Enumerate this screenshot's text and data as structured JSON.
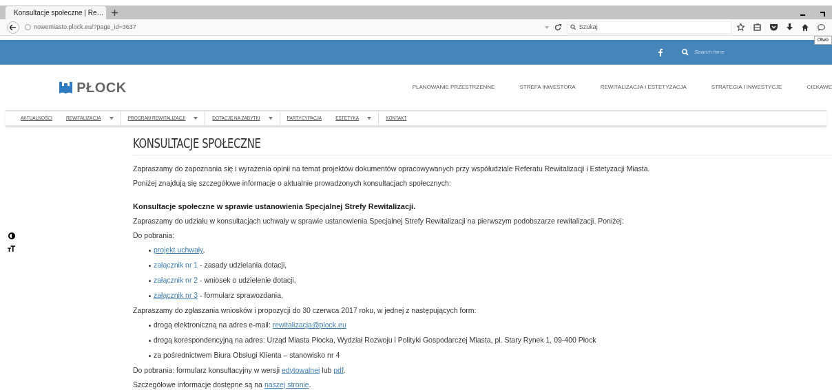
{
  "browser": {
    "tab_title": "Konsultacje społeczne | Re…",
    "url": "nowemiasto.plock.eu/?page_id=3637",
    "search_placeholder": "Szukaj",
    "tooltip": "Otwó"
  },
  "topbar": {
    "search_placeholder": "Search here"
  },
  "logo": {
    "text": "PŁOCK"
  },
  "main_nav": [
    "PLANOWANIE PRZESTRZENNE",
    "STREFA INWESTORA",
    "REWITALIZACJA I ESTETYZACJA",
    "STRATEGIA I INWESTYCJE",
    "CIEKAWE"
  ],
  "sub_nav": [
    {
      "label": "AKTUALNOŚCI",
      "dropdown": false
    },
    {
      "label": "REWITALIZACJA",
      "dropdown": true
    },
    {
      "label": "PROGRAM REWITALIZACJI",
      "dropdown": true
    },
    {
      "label": "DOTACJE NA ZABYTKI",
      "dropdown": true
    },
    {
      "label": "PARTYCYPACJA",
      "dropdown": false
    },
    {
      "label": "ESTETYKA",
      "dropdown": true
    },
    {
      "label": "KONTAKT",
      "dropdown": false
    }
  ],
  "page_title": "KONSULTACJE SPOŁECZNE",
  "content": [
    {
      "kind": "text",
      "parts": [
        {
          "text": "Zapraszamy do zapoznania się i wyrażenia opinii na temat projektów dokumentów opracowywanych przy współudziale Referatu Rewitalizacji i Estetyzacji Miasta."
        }
      ]
    },
    {
      "kind": "text",
      "parts": [
        {
          "text": "Poniżej znajdują się szczegółowe informacje o aktualnie prowadzonych konsultacjach społecznych:"
        }
      ]
    },
    {
      "kind": "heading",
      "parts": [
        {
          "text": "Konsultacje społeczne w sprawie ustanowienia Specjalnej Strefy Rewitalizacji."
        }
      ]
    },
    {
      "kind": "text",
      "parts": [
        {
          "text": "Zapraszamy do udziału w konsultacjach uchwały w sprawie ustanowienia Specjalnej Strefy Rewitalizacji na pierwszym podobszarze rewitalizacji. Poniżej:"
        }
      ]
    },
    {
      "kind": "text",
      "parts": [
        {
          "text": "Do pobrania:"
        }
      ]
    },
    {
      "kind": "bullet",
      "parts": [
        {
          "text": "projekt uchwały",
          "link": true,
          "underline": true
        },
        {
          "text": ","
        }
      ]
    },
    {
      "kind": "bullet",
      "parts": [
        {
          "text": "załącznik nr 1",
          "link": true,
          "underline": false
        },
        {
          "text": " - zasady udzielania dotacji,"
        }
      ]
    },
    {
      "kind": "bullet",
      "parts": [
        {
          "text": "załącznik nr 2",
          "link": true,
          "underline": false
        },
        {
          "text": " - wniosek o udzielenie dotacji,"
        }
      ]
    },
    {
      "kind": "bullet",
      "parts": [
        {
          "text": "załącznik nr 3",
          "link": true,
          "underline": true
        },
        {
          "text": " - formularz sprawozdania,"
        }
      ]
    },
    {
      "kind": "text",
      "parts": [
        {
          "text": "Zapraszamy do zgłaszania wniosków i propozycji do 30 czerwca 2017 roku, w jednej z następujących form:"
        }
      ]
    },
    {
      "kind": "bullet",
      "parts": [
        {
          "text": "drogą elektroniczną na adres e-mail: "
        },
        {
          "text": "rewitalizacja@plock.eu",
          "link": true,
          "underline": true
        }
      ]
    },
    {
      "kind": "bullet",
      "parts": [
        {
          "text": "drogą korespondencyjną na adres: Urząd Miasta Płocka, Wydział Rozwoju i Polityki Gospodarczej Miasta, pl. Stary Rynek 1, 09-400 Płock"
        }
      ]
    },
    {
      "kind": "bullet",
      "parts": [
        {
          "text": "za pośrednictwem Biura Obsługi Klienta – stanowisko nr 4"
        }
      ]
    },
    {
      "kind": "text",
      "parts": [
        {
          "text": "Do pobrania: formularz konsultacyjny w wersji "
        },
        {
          "text": "edytowalnej",
          "link": true,
          "underline": true
        },
        {
          "text": " lub "
        },
        {
          "text": "pdf",
          "link": true,
          "underline": true
        },
        {
          "text": "."
        }
      ]
    },
    {
      "kind": "text",
      "parts": [
        {
          "text": "Szczegółowe informacje dostępne są na "
        },
        {
          "text": "naszej stronie",
          "link": true,
          "underline": true
        },
        {
          "text": "."
        }
      ]
    }
  ]
}
